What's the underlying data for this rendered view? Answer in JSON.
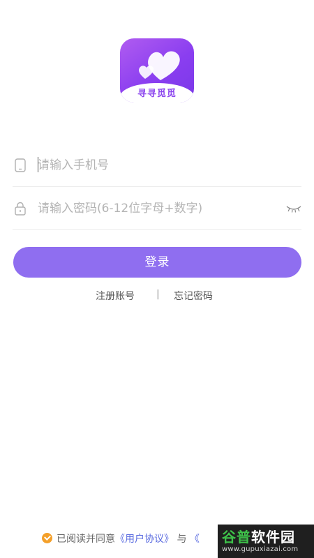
{
  "app": {
    "logo_text": "寻寻觅觅"
  },
  "form": {
    "phone_placeholder": "请输入手机号",
    "password_placeholder": "请输入密码(6-12位字母+数字)",
    "login_label": "登录"
  },
  "links": {
    "register": "注册账号",
    "separator": "|",
    "forgot": "忘记密码"
  },
  "agreement": {
    "prefix": "已阅读并同意",
    "user_agreement": "《用户协议》",
    "conjunction": "与",
    "next_fragment": "《"
  },
  "watermark": {
    "title_green": "谷普",
    "title_white": "软件园",
    "url": "www.gupuxiazai.com"
  },
  "colors": {
    "accent": "#8f6ef0",
    "logo_gradient_start": "#b05cf0",
    "logo_gradient_end": "#7a38e8",
    "check": "#f4a02a",
    "link": "#5b6ce0"
  }
}
